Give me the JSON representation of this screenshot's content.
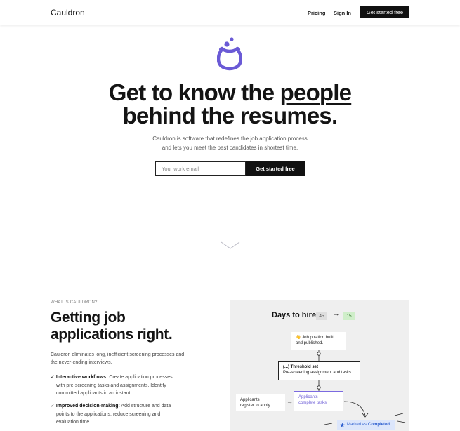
{
  "header": {
    "brand": "Cauldron",
    "nav": {
      "pricing": "Pricing",
      "sign_in": "Sign In",
      "cta": "Get started free"
    }
  },
  "hero": {
    "title_line1_pre": "Get to know the ",
    "title_line1_em": "people",
    "title_line2": "behind the resumes.",
    "subtitle_line1": "Cauldron is software that redefines the job application process",
    "subtitle_line2": "and lets you meet the best candidates in shortest time.",
    "email_placeholder": "Your work email",
    "cta": "Get started free",
    "logo_icon": "cauldron-logo-icon",
    "scroll_icon": "chevron-down-icon",
    "accent": "#6a5ad6"
  },
  "what": {
    "eyebrow": "WHAT IS CAULDRON?",
    "title_line1": "Getting job",
    "title_line2": "applications right.",
    "desc": "Cauldron eliminates long, inefficient screening processes and the never-ending interviews.",
    "features": [
      {
        "check": "✓",
        "title": "Interactive workflows:",
        "text_line1": "Create application processes",
        "text_line2": "with pre-screening tasks and assignments. Identify",
        "text_line3": "committed applicants in an instant."
      },
      {
        "check": "✓",
        "title": "Improved decision-making:",
        "text_line1": "Add structure and data",
        "text_line2": "points to the applications, reduce screening and",
        "text_line3": "evaluation time."
      }
    ]
  },
  "diagram": {
    "title": "Days to hire",
    "before": "45",
    "arrow": "→",
    "after": "15",
    "job_node_line1": "👋 Job position built",
    "job_node_line2": "and published.",
    "threshold_title": "(...) Threshold set",
    "threshold_text": "Pre-screening assignment and tasks",
    "register_line1": "Applicants",
    "register_line2": "register to apply",
    "complete_line1": "Applicants",
    "complete_line2": "complete tasks",
    "flow_arrow": "→",
    "badge_pre": "Marked as",
    "badge_status": "Completed",
    "badge_icon": "star-icon",
    "colors": {
      "before_bg": "#dedede",
      "after_bg": "#cfeec9",
      "badge_bg": "#dce6fb"
    }
  }
}
